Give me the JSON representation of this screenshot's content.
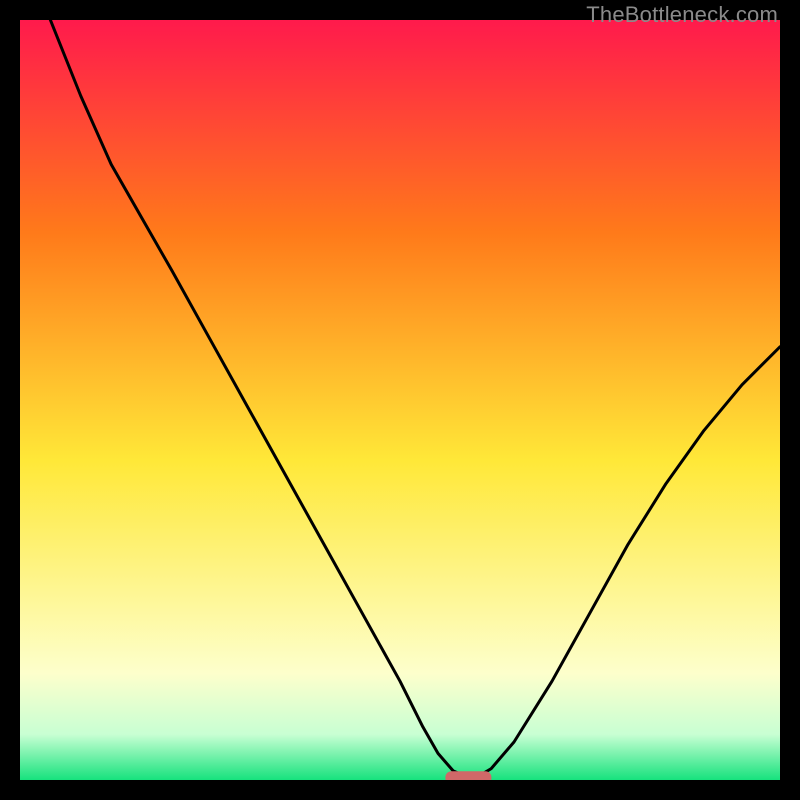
{
  "watermark": "TheBottleneck.com",
  "colors": {
    "gradient_top": "#ff1a4c",
    "gradient_mid1": "#ff7a1a",
    "gradient_mid2": "#ffe838",
    "gradient_low1": "#fdffcc",
    "gradient_low2": "#c8ffd3",
    "gradient_bottom": "#16e27d",
    "curve": "#000000",
    "marker": "#d06868",
    "frame": "#000000"
  },
  "chart_data": {
    "type": "line",
    "title": "",
    "xlabel": "",
    "ylabel": "",
    "xlim": [
      0,
      100
    ],
    "ylim": [
      0,
      100
    ],
    "series": [
      {
        "name": "bottleneck-curve",
        "x": [
          4,
          8,
          12,
          16,
          20,
          25,
          30,
          35,
          40,
          45,
          50,
          53,
          55,
          57,
          59,
          60,
          62,
          65,
          70,
          75,
          80,
          85,
          90,
          95,
          100
        ],
        "y": [
          100,
          90,
          81,
          74,
          67,
          58,
          49,
          40,
          31,
          22,
          13,
          7,
          3.5,
          1.2,
          0.3,
          0.3,
          1.5,
          5,
          13,
          22,
          31,
          39,
          46,
          52,
          57
        ]
      }
    ],
    "annotations": [
      {
        "name": "optimal-marker",
        "x": 59,
        "y": 0.3,
        "shape": "rounded-bar"
      }
    ],
    "background": "vertical-gradient (red → orange → yellow → pale-yellow → pale-green → green)"
  }
}
